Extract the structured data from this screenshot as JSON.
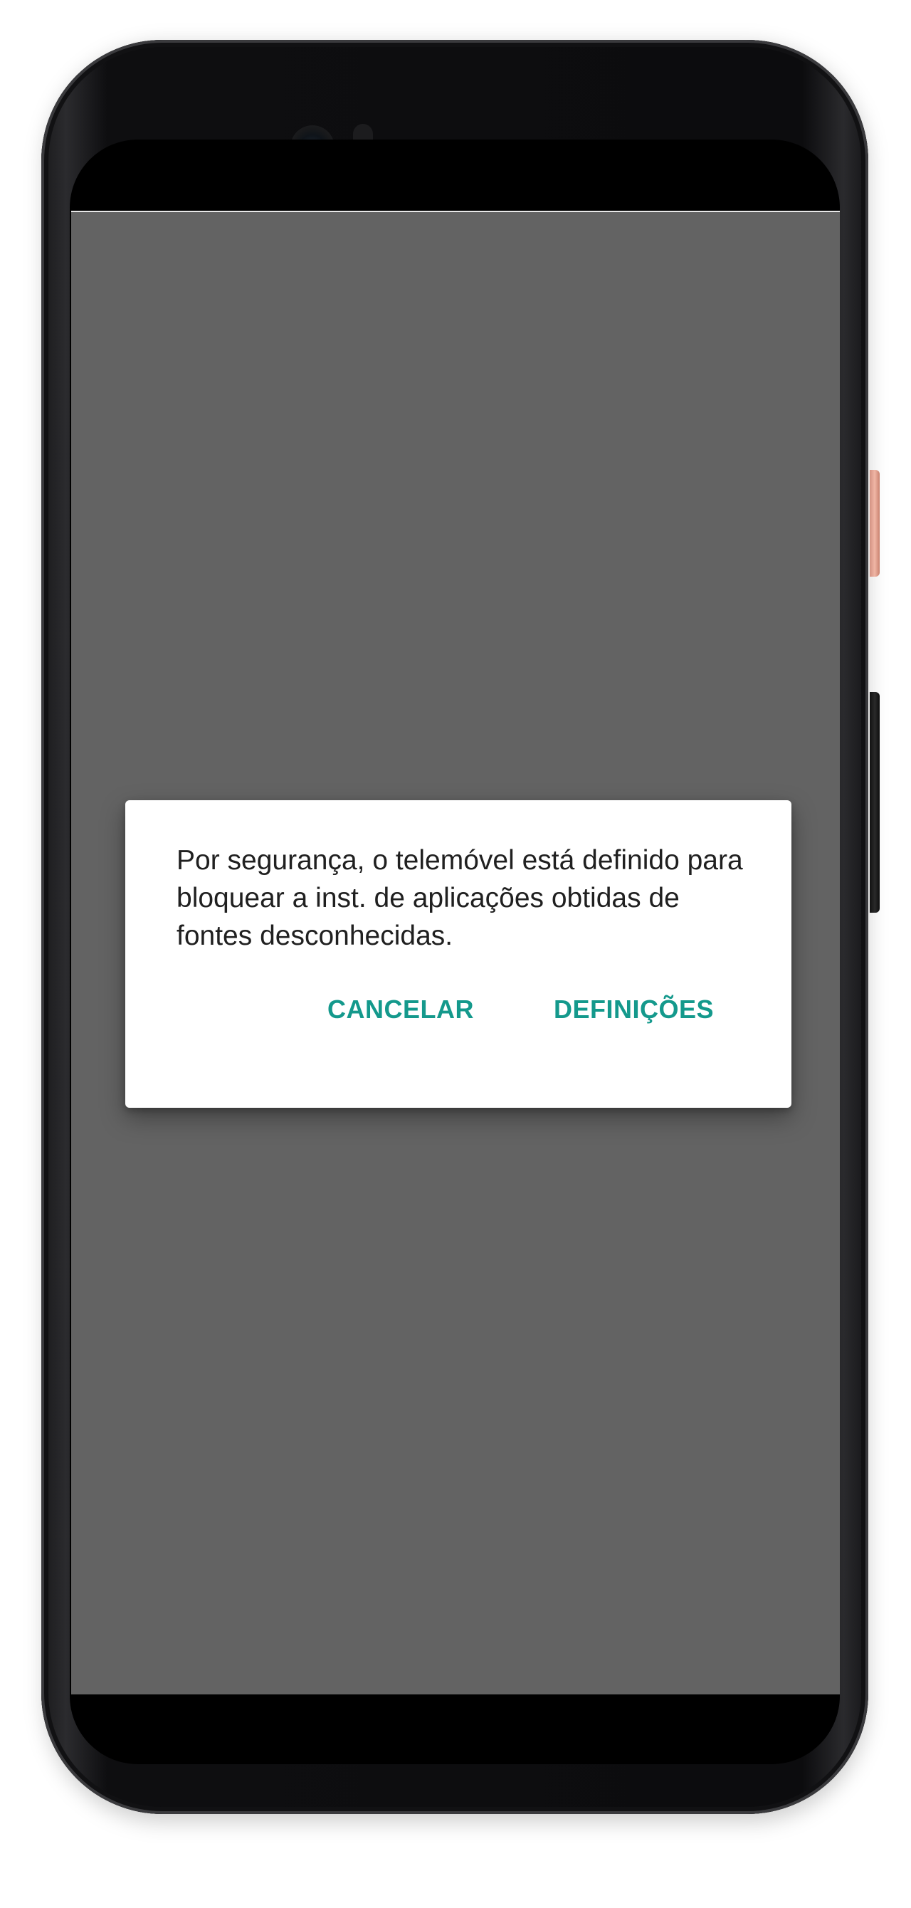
{
  "dialog": {
    "message": "Por segurança, o telemóvel está definido para bloquear a inst. de aplicações obtidas de fontes desconhecidas.",
    "cancel_label": "CANCELAR",
    "settings_label": "DEFINIÇÕES"
  },
  "colors": {
    "scrim": "#636363",
    "dialog_background": "#ffffff",
    "accent": "#14998c",
    "message_text": "#202020"
  },
  "icons": {
    "front_camera": "front-camera-icon",
    "earpiece": "speaker-grille-icon"
  }
}
